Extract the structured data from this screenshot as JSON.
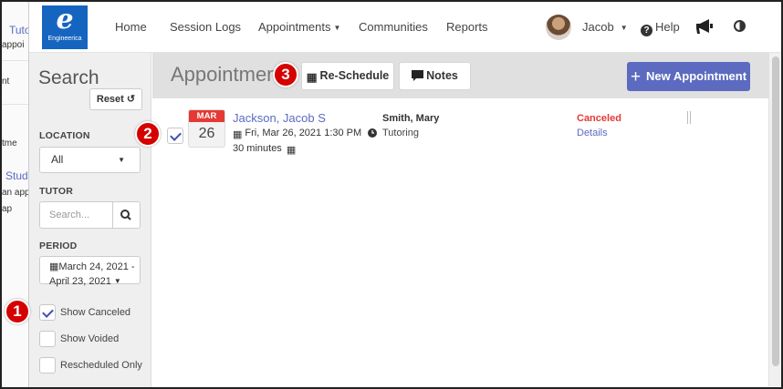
{
  "background_page": {
    "fragments": [
      "Tuto",
      "appoi",
      "nt",
      "tme",
      "Stud",
      "an app",
      "ap"
    ]
  },
  "navbar": {
    "logo_glyph": "e",
    "logo_brand": "Engineerica",
    "links": [
      "Home",
      "Session Logs",
      "Appointments",
      "Communities",
      "Reports"
    ],
    "user_name": "Jacob",
    "help_label": "Help",
    "icons": [
      "megaphone-icon",
      "contrast-icon",
      "question-circle-icon",
      "caret-down-icon"
    ]
  },
  "sidebar": {
    "title": "Search",
    "reset_label": "Reset",
    "location_label": "LOCATION",
    "location_value": "All",
    "tutor_label": "TUTOR",
    "tutor_placeholder": "Search...",
    "period_label": "PERIOD",
    "period_line1": "March 24, 2021 -",
    "period_line2": "April 23, 2021",
    "show_canceled_label": "Show Canceled",
    "show_canceled_checked": true,
    "show_voided_label": "Show Voided",
    "show_voided_checked": false,
    "rescheduled_only_label": "Rescheduled Only",
    "rescheduled_only_checked": false
  },
  "main": {
    "title": "Appointmen",
    "reschedule_label": "Re-Schedule",
    "notes_label": "Notes",
    "new_appointment_label": "New Appointment"
  },
  "appointment": {
    "checked": true,
    "month": "MAR",
    "day": "26",
    "student": "Jackson, Jacob S",
    "datetime": "Fri, Mar 26, 2021 1:30 PM",
    "duration": "30 minutes",
    "tutor": "Smith, Mary",
    "service": "Tutoring",
    "status": "Canceled",
    "details_label": "Details"
  },
  "callouts": [
    "1",
    "2",
    "3"
  ],
  "colors": {
    "accent": "#5c6bc0",
    "brand": "#1565c0",
    "danger": "#e53935",
    "callout": "#d50000"
  }
}
